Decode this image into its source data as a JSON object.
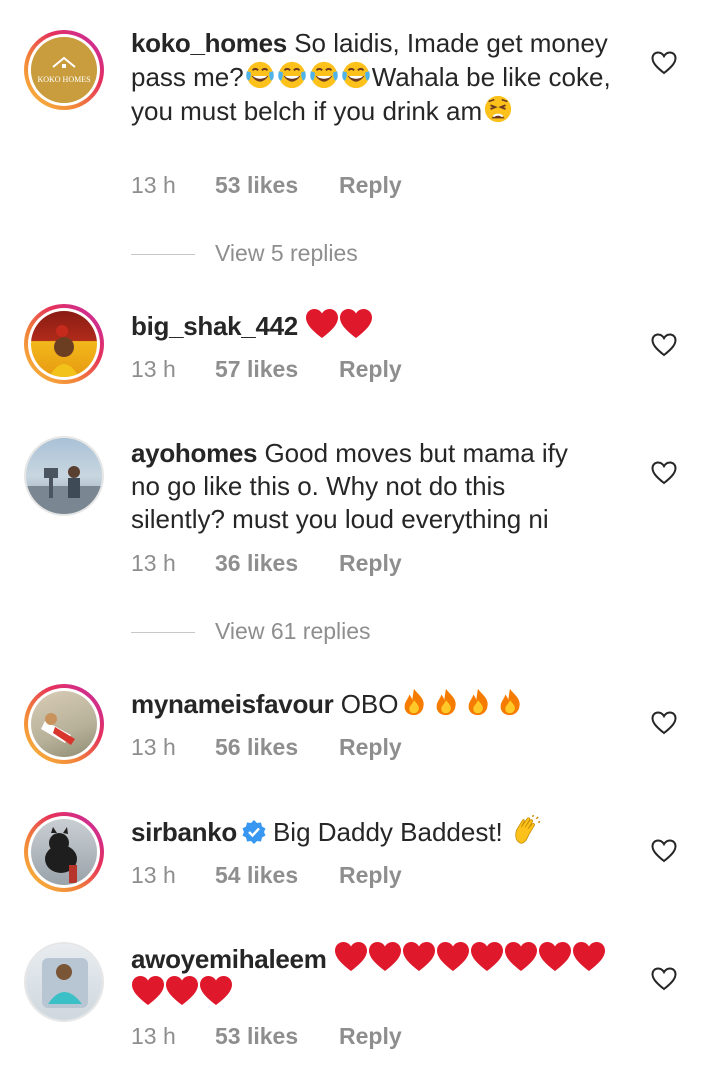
{
  "comments": [
    {
      "username": "koko_homes",
      "text_before": "So laidis, Imade get money pass me?",
      "emoji_mid": [
        "joy-emoji",
        "joy-emoji",
        "joy-emoji",
        "joy-emoji"
      ],
      "text_after": "Wahala be like coke, you must belch if you drink am",
      "emoji_end": [
        "weary-emoji"
      ],
      "avatar_text": "KOKO HOMES",
      "time": "13 h",
      "likes": "53 likes",
      "reply": "Reply",
      "view_replies": "View 5 replies"
    },
    {
      "username": "big_shak_442",
      "text_before": "",
      "emoji_end": [
        "red-heart-emoji",
        "red-heart-emoji"
      ],
      "time": "13 h",
      "likes": "57 likes",
      "reply": "Reply"
    },
    {
      "username": "ayohomes",
      "text_before": "Good moves but mama ify no go like this o. Why not do this silently? must you loud everything ni",
      "time": "13 h",
      "likes": "36 likes",
      "reply": "Reply",
      "view_replies": "View 61 replies"
    },
    {
      "username": "mynameisfavour",
      "text_before": "OBO",
      "emoji_end": [
        "fire-emoji",
        "fire-emoji",
        "fire-emoji",
        "fire-emoji"
      ],
      "time": "13 h",
      "likes": "56 likes",
      "reply": "Reply"
    },
    {
      "username": "sirbanko",
      "verified": true,
      "text_before": "Big Daddy Baddest!",
      "emoji_end": [
        "clapping-hands-emoji"
      ],
      "time": "13 h",
      "likes": "54 likes",
      "reply": "Reply"
    },
    {
      "username": "awoyemihaleem",
      "text_before": "",
      "emoji_end": [
        "red-heart-emoji",
        "red-heart-emoji",
        "red-heart-emoji",
        "red-heart-emoji",
        "red-heart-emoji",
        "red-heart-emoji",
        "red-heart-emoji",
        "red-heart-emoji",
        "red-heart-emoji",
        "red-heart-emoji",
        "red-heart-emoji"
      ],
      "time": "13 h",
      "likes": "53 likes",
      "reply": "Reply"
    }
  ],
  "colors": {
    "text": "#262626",
    "meta": "#8e8e8e",
    "verified": "#3897f0",
    "heart_emoji": "#e0182b",
    "story_ring": [
      "#f9c23c",
      "#e5315b",
      "#c02bb5"
    ]
  },
  "icons": {
    "like": "heart-outline-icon",
    "verified": "verified-badge-icon"
  }
}
